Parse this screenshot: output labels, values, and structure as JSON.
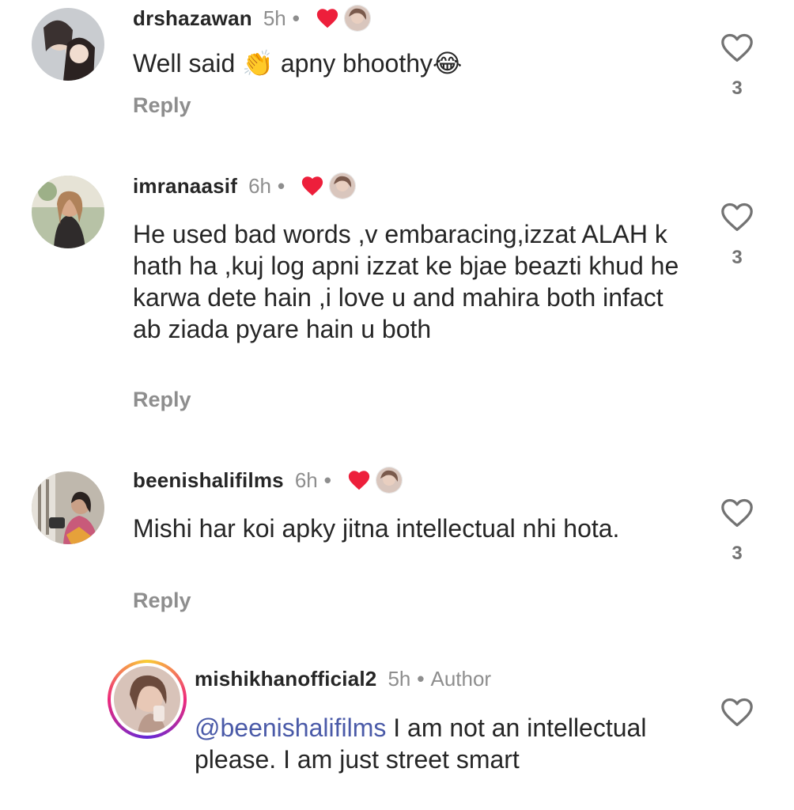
{
  "comments": [
    {
      "username": "drshazawan",
      "time": "5h",
      "text": "Well said 👏 apny bhoothy😂",
      "reply": "Reply",
      "likes": "3"
    },
    {
      "username": "imranaasif",
      "time": "6h",
      "text": "He used bad words ,v embaracing,izzat ALAH k hath ha ,kuj log apni izzat ke bjae beazti khud he karwa dete hain ,i love u and mahira both infact ab ziada pyare hain u both",
      "reply": "Reply",
      "likes": "3"
    },
    {
      "username": "beenishalifilms",
      "time": "6h",
      "text": "Mishi har koi apky jitna intellectual nhi hota.",
      "reply": "Reply",
      "likes": "3"
    }
  ],
  "author_reply": {
    "username": "mishikhanofficial2",
    "time": "5h",
    "author_label": "Author",
    "mention": "@beenishalifilms",
    "text": " I am not an intellectual please. I am just street smart"
  },
  "dot": "•",
  "icons": {
    "like": "heart-outline-icon",
    "creator_liked": "red-heart-icon",
    "creator_avatar": "creator-mini-avatar"
  },
  "colors": {
    "creator_heart": "#ed1f3b",
    "secondary_text": "#8e8e8e",
    "mention": "#4a5aa8"
  }
}
